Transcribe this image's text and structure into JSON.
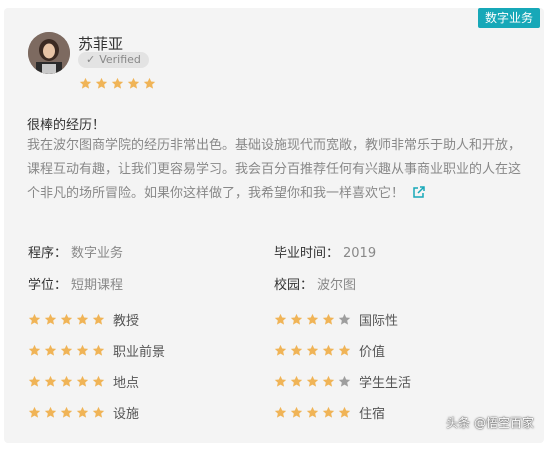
{
  "tag": "数字业务",
  "reviewer": {
    "name": "苏菲亚",
    "verified_label": "Verified",
    "rating": 5
  },
  "review": {
    "title": "很棒的经历！",
    "body": "我在波尔图商学院的经历非常出色。基础设施现代而宽敞，教师非常乐于助人和开放，课程互动有趣，让我们更容易学习。我会百分百推荐任何有兴趣从事商业职业的人在这个非凡的场所冒险。如果你这样做了，我希望你和我一样喜欢它！"
  },
  "info": {
    "program_label": "程序：",
    "program": "数字业务",
    "graduation_label": "毕业时间：",
    "graduation": "2019",
    "degree_label": "学位：",
    "degree": "短期课程",
    "campus_label": "校园：",
    "campus": "波尔图"
  },
  "ratings": {
    "left": [
      {
        "label": "教授",
        "stars": 5
      },
      {
        "label": "职业前景",
        "stars": 5
      },
      {
        "label": "地点",
        "stars": 5
      },
      {
        "label": "设施",
        "stars": 5
      }
    ],
    "right": [
      {
        "label": "国际性",
        "stars": 4
      },
      {
        "label": "价值",
        "stars": 5
      },
      {
        "label": "学生生活",
        "stars": 4
      },
      {
        "label": "住宿",
        "stars": 5
      }
    ]
  },
  "colors": {
    "star_on": "#f0b457",
    "star_off": "#9e9e9e",
    "accent": "#17a8b8"
  },
  "watermark": "头条 @悟空百家"
}
